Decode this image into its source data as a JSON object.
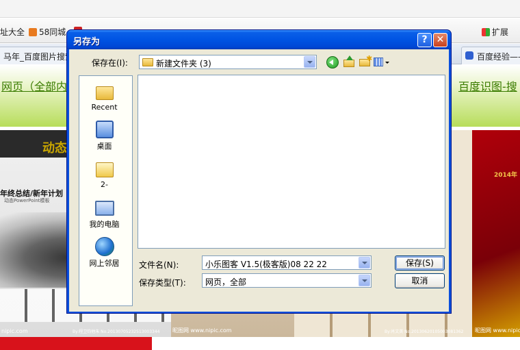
{
  "browser": {
    "bookmarks": [
      {
        "label": "址大全",
        "color": "#d0d0d0"
      },
      {
        "label": "58同城",
        "color": "#e87a1f"
      },
      {
        "label": "",
        "color": "#cc2222"
      },
      {
        "label": "",
        "color": "#cc2222"
      },
      {
        "label": "",
        "color": "#7a7a7a"
      },
      {
        "label": "",
        "color": "#cc3333"
      },
      {
        "label": "",
        "color": "#777777"
      },
      {
        "label": "",
        "color": "#aa1111"
      }
    ],
    "extension_label": "扩展",
    "tabs": [
      {
        "label": "马年_百度图片搜索"
      },
      {
        "label": "百度经验——"
      }
    ],
    "page_link_left": "网页（全部内",
    "page_link_right": "百度识图-搜",
    "gallery": {
      "card1_title": "动态",
      "card1_subtitle": "年终总结/新年计划",
      "card1_caption": "动态PowerPoint模板",
      "card4_year": "2014年",
      "watermarks": [
        "nipic.com",
        "By:程卫钧他朱 No.20130705232513003344",
        "昵图网 www.nipic.com",
        "By:肖文英 No.20130620105003081362",
        "昵图网 www.nipic.com"
      ]
    }
  },
  "dialog": {
    "title": "另存为",
    "help_glyph": "?",
    "close_glyph": "✕",
    "save_in_label": "保存在(I):",
    "current_folder": "新建文件夹 (3)",
    "places": [
      {
        "label": "Recent",
        "icon": "recent-folder-icon"
      },
      {
        "label": "桌面",
        "icon": "desktop-icon"
      },
      {
        "label": "2-",
        "icon": "documents-icon"
      },
      {
        "label": "我的电脑",
        "icon": "my-computer-icon"
      },
      {
        "label": "网上邻居",
        "icon": "network-places-icon"
      }
    ],
    "filename_label": "文件名(N):",
    "filename_value": "小乐图客 V1.5(极客版)08 22 22",
    "filetype_label": "保存类型(T):",
    "filetype_value": "网页，全部",
    "save_button": "保存(S)",
    "cancel_button": "取消"
  }
}
